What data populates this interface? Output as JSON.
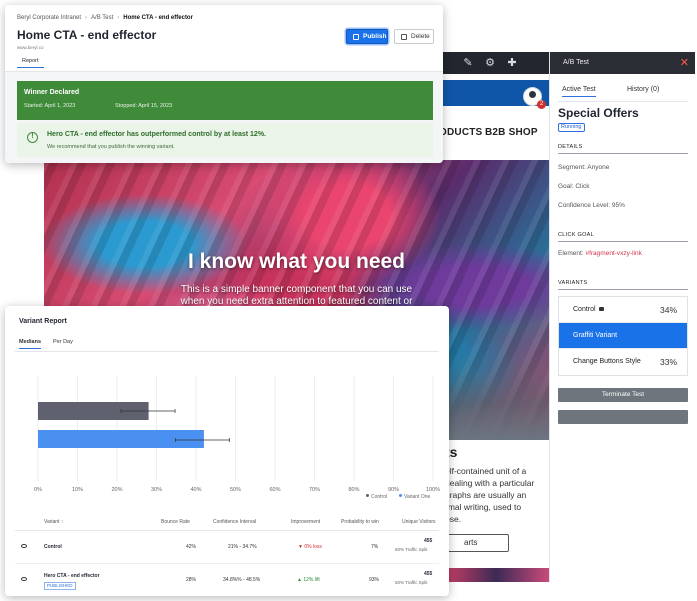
{
  "background_page": {
    "toolbar_icons": [
      "pencil-icon",
      "gear-icon",
      "puzzle-icon"
    ],
    "nav": [
      "ODUCTS",
      "B2B SHOP"
    ],
    "notification_count": "2",
    "banner": {
      "title": "I know what you need",
      "text_line1": "This is a simple banner component that you can use",
      "text_line2": "when you need extra attention to featured content or"
    },
    "section_title": "ts",
    "paragraph": [
      "elf-contained unit of a",
      "dealing with a particular",
      "graphs are usually an",
      "rmal writing, used to",
      "ose."
    ],
    "cta_label": "arts"
  },
  "ab_panel": {
    "header_title": "A/B Test",
    "close_symbol": "✕",
    "tabs": [
      {
        "label": "Active Test",
        "active": true
      },
      {
        "label": "History (0)",
        "active": false
      }
    ],
    "experience_name": "Special Offers",
    "status": "Running",
    "details_heading": "DETAILS",
    "segment_label": "Segment:",
    "segment_value": "Anyone",
    "goal_label": "Goal:",
    "goal_value": "Click",
    "confidence_label": "Confidence Level:",
    "confidence_value": "95%",
    "click_goal_heading": "CLICK GOAL",
    "element_label": "Element:",
    "element_value": "#fragment-vxzy-link",
    "variants_heading": "VARIANTS",
    "variants": [
      {
        "name": "Control",
        "percent": "34%",
        "locked": true,
        "selected": false
      },
      {
        "name": "Graffiti Variant",
        "percent": "33%",
        "locked": false,
        "selected": true
      },
      {
        "name": "Change Buttons Style",
        "percent": "33%",
        "locked": false,
        "selected": false
      }
    ],
    "terminate_label": "Terminate Test",
    "second_button_label": ""
  },
  "top_card": {
    "breadcrumb": [
      "Beryl Corporate Intranet",
      "A/B Test",
      "Home CTA - end effector"
    ],
    "title": "Home CTA - end effector",
    "site_url": "www.beryl.co",
    "publish_label": "Publish",
    "delete_label": "Delete",
    "tab_label": "Report",
    "winner_title": "Winner Declared",
    "started": "Started: April 1, 2023",
    "stopped": "Stopped: April 15, 2023",
    "alert_title": "Hero CTA - end effector has outperformed control by at least 12%.",
    "alert_sub": "We recommend that you publish the winning variant."
  },
  "report": {
    "title": "Variant Report",
    "tabs": [
      {
        "label": "Medians",
        "active": true
      },
      {
        "label": "Per Day",
        "active": false
      }
    ],
    "legend": [
      {
        "name": "Control",
        "color": "#5f626e"
      },
      {
        "name": "Variant One",
        "color": "#4a90f0"
      }
    ],
    "table": {
      "headers": [
        "Variant ↑",
        "Bounce Rate",
        "Confidence Interval",
        "Improvement",
        "Probability to win",
        "Unique Visitors"
      ],
      "rows": [
        {
          "name": "Control",
          "tag": "",
          "bounce": "42%",
          "ci": "21% - 34.7%",
          "improvement": "▼ 0% loss",
          "improvement_dir": "down",
          "probability": "7%",
          "visitors": "455",
          "split": "50% Traffic Split"
        },
        {
          "name": "Hero CTA - end effector",
          "tag": "PUBLISHED",
          "bounce": "28%",
          "ci": "34.8%% - 48.5%",
          "improvement": "▲ 12% lift",
          "improvement_dir": "up",
          "probability": "93%",
          "visitors": "455",
          "split": "50% Traffic Split"
        }
      ]
    }
  },
  "chart_data": {
    "type": "bar",
    "orientation": "horizontal",
    "categories": [
      "Control",
      "Variant One"
    ],
    "values": [
      28,
      42
    ],
    "error_bars": [
      [
        21,
        34.7
      ],
      [
        34.8,
        48.5
      ]
    ],
    "colors": [
      "#5f626e",
      "#4a90f0"
    ],
    "xlim": [
      0,
      100
    ],
    "x_ticks": [
      "0%",
      "10%",
      "20%",
      "30%",
      "40%",
      "50%",
      "60%",
      "70%",
      "80%",
      "90%",
      "100%"
    ],
    "grid": true,
    "legend_position": "bottom-right",
    "title": "",
    "xlabel": "",
    "ylabel": ""
  }
}
